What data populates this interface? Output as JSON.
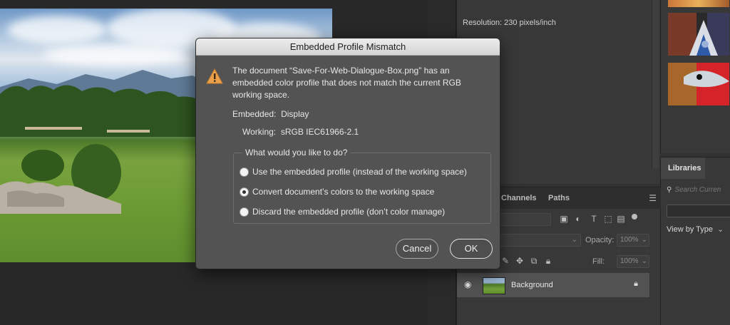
{
  "document": {
    "image_description_alt": ""
  },
  "properties": {
    "resolution": "Resolution: 230 pixels/inch"
  },
  "libraries": {
    "tab": "Libraries",
    "search_placeholder": "Search Curren",
    "view_label": "View by Type"
  },
  "layers_panel": {
    "tabs": [
      "Channels",
      "Paths"
    ],
    "opacity_label": "Opacity:",
    "opacity_value": "100%",
    "fill_label": "Fill:",
    "fill_value": "100%",
    "layer": {
      "name": "Background"
    }
  },
  "dialog": {
    "title": "Embedded Profile Mismatch",
    "message": "The document “Save-For-Web-Dialogue-Box.png” has an embedded color profile that does not match the current RGB working space.",
    "embedded_label": "Embedded:",
    "embedded_value": "Display",
    "working_label": "Working:",
    "working_value": "sRGB IEC61966-2.1",
    "question": "What would you like to do?",
    "options": [
      "Use the embedded profile (instead of the working space)",
      "Convert document’s colors to the working space",
      "Discard the embedded profile (don’t color manage)"
    ],
    "selected_option": 1,
    "cancel_label": "Cancel",
    "ok_label": "OK"
  },
  "colors": {
    "dialog_bg": "#535353",
    "panel_bg": "#383838",
    "warning": "#e8a04a"
  },
  "icons": [
    "warning-icon",
    "search-icon",
    "chevron-down-icon",
    "panel-menu-icon",
    "eye-icon",
    "lock-icon",
    "image-filter-icon",
    "adjustment-filter-icon",
    "type-filter-icon",
    "shape-filter-icon",
    "smart-object-filter-icon",
    "brush-lock-icon",
    "move-lock-icon",
    "artboard-lock-icon"
  ]
}
